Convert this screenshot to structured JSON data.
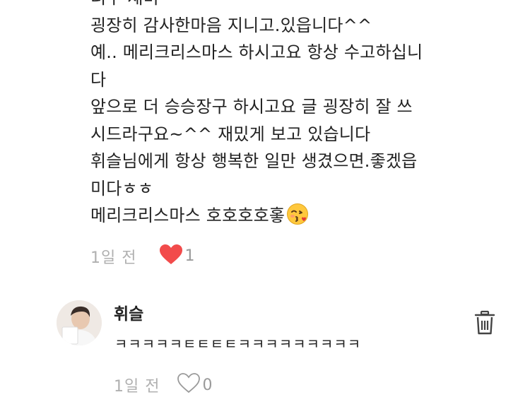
{
  "comment": {
    "lines": [
      "너무 재미",
      "굉장히 감사한마음 지니고.있읍니다^^",
      "예.. 메리크리스마스 하시고요 항상 수고하십니",
      "다",
      "앞으로 더 승승장구 하시고요 글 굉장히 잘 쓰",
      "시드라구요~^^ 재밌게 보고 있습니다",
      "휘슬님에게 항상 행복한 일만 생겼으면.좋겠읍",
      "미다ㅎㅎ",
      "메리크리스마스 호호호호홓"
    ],
    "emoji_icon": "kissing-face-icon",
    "time": "1일 전",
    "like_count": "1",
    "like_state": "liked",
    "like_color": "#f24b4b"
  },
  "reply": {
    "author": "휘슬",
    "text": "ㅋㅋㅋㅋㅋㅌㅌㅌㅌㅋㅋㅋㅋㅋㅋㅋㅋㅋ",
    "time": "1일 전",
    "like_count": "0",
    "like_state": "not-liked",
    "delete_icon": "trash-icon"
  }
}
